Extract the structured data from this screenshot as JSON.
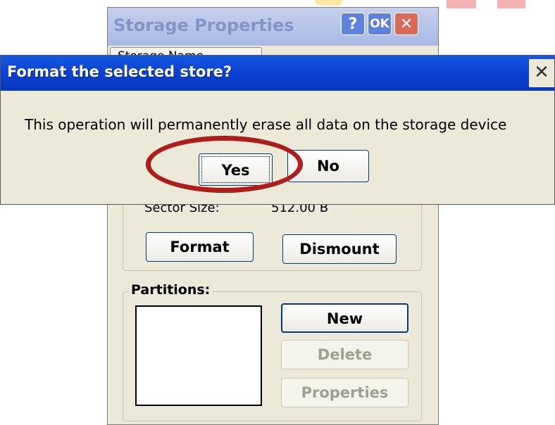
{
  "storage_window": {
    "title": "Storage Properties",
    "help_label": "?",
    "ok_label": "OK",
    "close_label": "✕",
    "tab_label": "Storage Name",
    "sector_size_label": "Sector Size:",
    "sector_size_value": "512.00 B",
    "format_label": "Format",
    "dismount_label": "Dismount",
    "partitions_label": "Partitions:",
    "new_label": "New",
    "delete_label": "Delete",
    "properties_label": "Properties"
  },
  "dialog": {
    "title": "Format the selected store?",
    "close_label": "✕",
    "message": "This operation will permanently erase all data on the storage device",
    "yes_label": "Yes",
    "no_label": "No"
  },
  "colors": {
    "highlight": "#b31b1b",
    "titlebar": "#0a3fcf"
  }
}
